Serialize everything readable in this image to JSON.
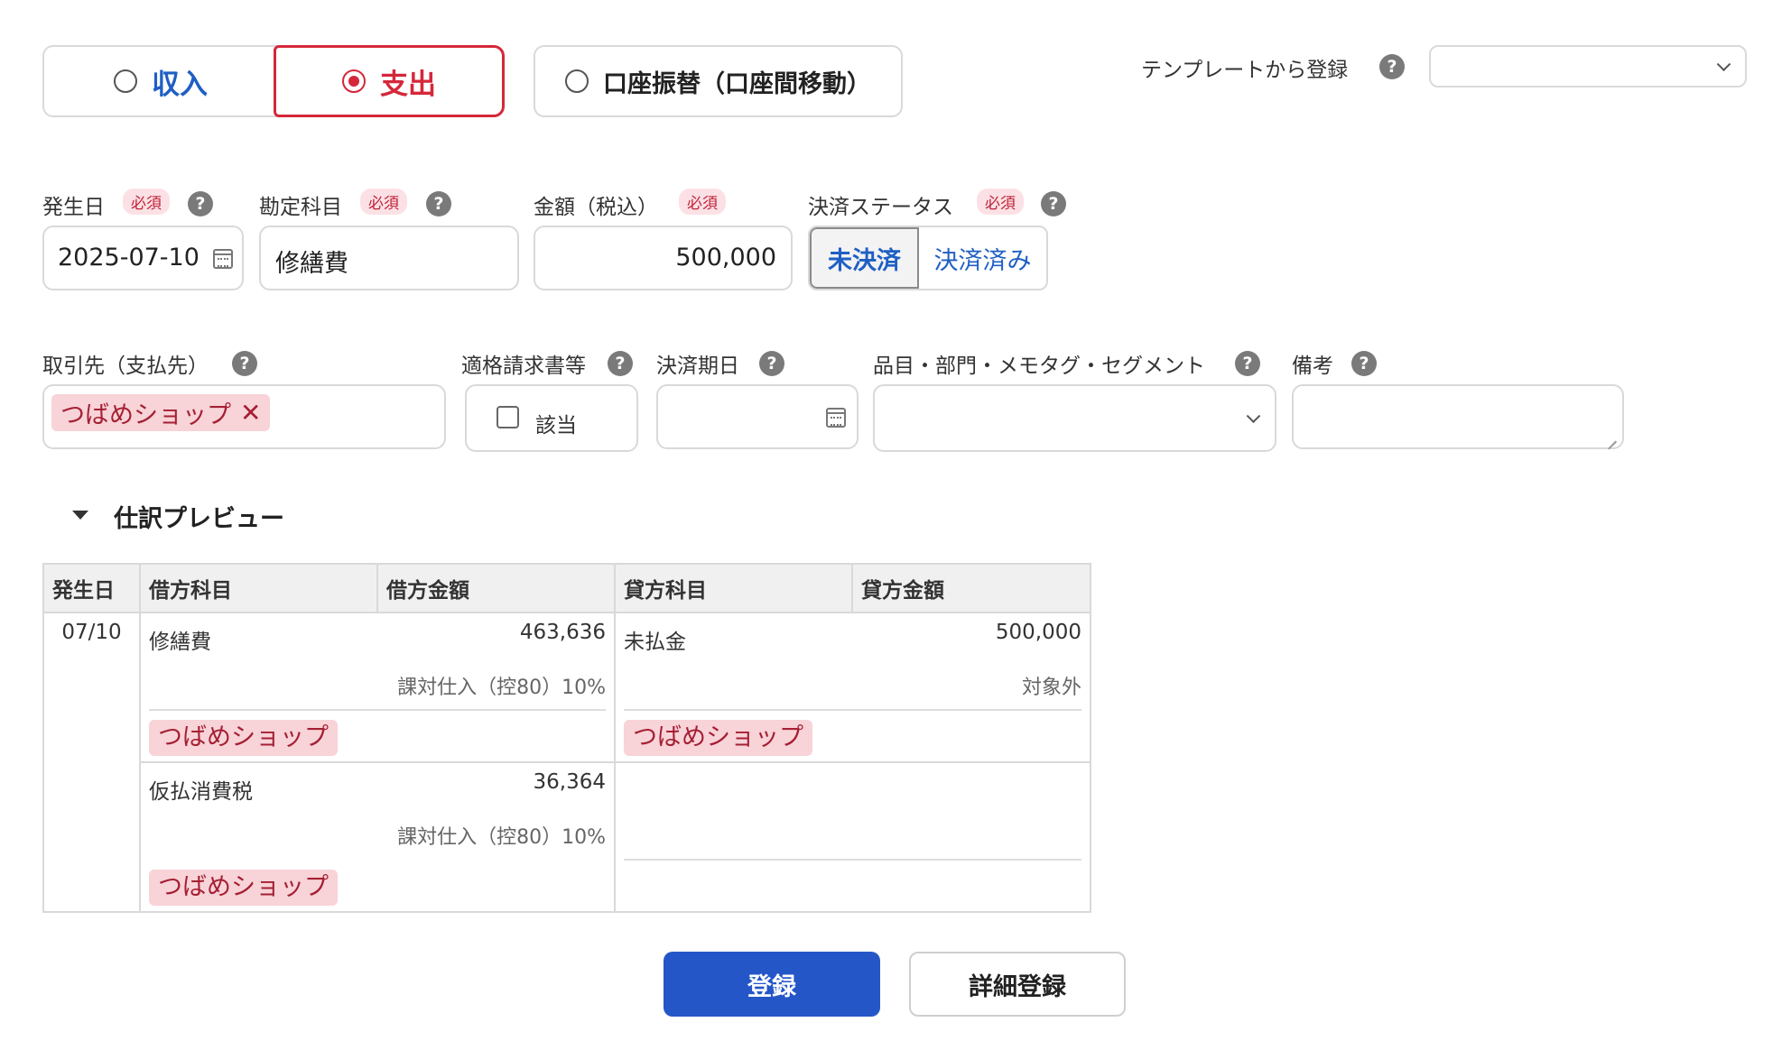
{
  "type_selector": {
    "income": "収入",
    "expense": "支出",
    "transfer": "口座振替（口座間移動）",
    "selected": "expense"
  },
  "template": {
    "label": "テンプレートから登録",
    "value": ""
  },
  "help_glyph": "?",
  "required_label": "必須",
  "fields": {
    "date": {
      "label": "発生日",
      "value": "2025-07-10"
    },
    "account": {
      "label": "勘定科目",
      "value": "修繕費"
    },
    "amount": {
      "label": "金額（税込）",
      "value": "500,000"
    },
    "status": {
      "label": "決済ステータス",
      "unpaid": "未決済",
      "paid": "決済済み",
      "selected": "unpaid"
    },
    "partner": {
      "label": "取引先（支払先）",
      "chip": "つばめショップ"
    },
    "invoice": {
      "label": "適格請求書等",
      "checkbox_label": "該当",
      "checked": false
    },
    "due_date": {
      "label": "決済期日",
      "value": ""
    },
    "tags": {
      "label": "品目・部門・メモタグ・セグメント",
      "value": ""
    },
    "memo": {
      "label": "備考",
      "value": ""
    }
  },
  "preview": {
    "title": "仕訳プレビュー",
    "headers": [
      "発生日",
      "借方科目",
      "借方金額",
      "貸方科目",
      "貸方金額"
    ],
    "date": "07/10",
    "rows": [
      {
        "debit_account": "修繕費",
        "debit_amount": "463,636",
        "debit_tax": "課対仕入（控80）10%",
        "debit_partner": "つばめショップ",
        "credit_account": "未払金",
        "credit_amount": "500,000",
        "credit_tax": "対象外",
        "credit_partner": "つばめショップ"
      },
      {
        "debit_account": "仮払消費税",
        "debit_amount": "36,364",
        "debit_tax": "課対仕入（控80）10%",
        "debit_partner": "つばめショップ",
        "credit_account": "",
        "credit_amount": "",
        "credit_tax": "",
        "credit_partner": ""
      }
    ]
  },
  "buttons": {
    "register": "登録",
    "detail_register": "詳細登録"
  },
  "colors": {
    "accent_blue": "#2456c8",
    "expense_red": "#d5273a",
    "chip_bg": "#f8d3d8"
  },
  "icons": [
    "radio-icon",
    "help-icon",
    "calendar-icon",
    "chevron-down-icon",
    "close-icon",
    "caret-down-icon",
    "resize-handle-icon"
  ]
}
